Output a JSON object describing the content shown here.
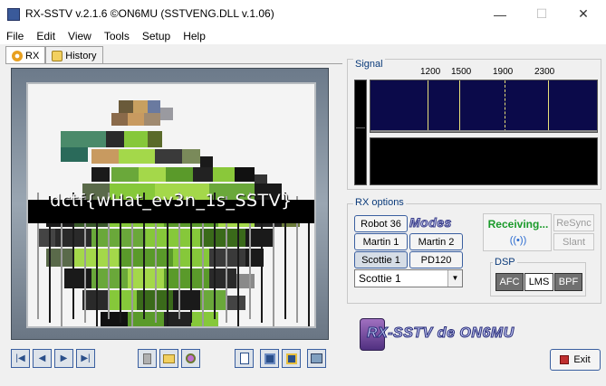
{
  "window": {
    "title": "RX-SSTV v.2.1.6 ©ON6MU (SSTVENG.DLL v.1.06)",
    "controls": {
      "minimize": "—",
      "maximize": "☐",
      "close": "✕"
    }
  },
  "menu": [
    "File",
    "Edit",
    "View",
    "Tools",
    "Setup",
    "Help"
  ],
  "tabs": [
    {
      "label": "RX",
      "icon": "gear-icon"
    },
    {
      "label": "History",
      "icon": "history-icon"
    }
  ],
  "image": {
    "overlay_text": "dctf{wHat_ev3n_1s_SSTV}"
  },
  "toolbar": {
    "nav": [
      "first-icon",
      "prev-icon",
      "next-icon",
      "last-icon"
    ],
    "file": [
      "trash-icon",
      "open-folder-icon",
      "zoom-icon"
    ],
    "save": [
      "copy-icon",
      "save-icon",
      "save-as-icon",
      "scan-icon"
    ]
  },
  "signal": {
    "label": "Signal",
    "freqs": [
      "1200",
      "1500",
      "1900",
      "2300"
    ]
  },
  "rx_options": {
    "label": "RX options",
    "modes_logo": "Modes",
    "buttons": {
      "robot36": "Robot 36",
      "martin1": "Martin 1",
      "martin2": "Martin 2",
      "scottie1": "Scottie 1",
      "pd120": "PD120"
    },
    "selected_mode": "Scottie 1",
    "status": "Receiving...",
    "resync": "ReSync",
    "slant": "Slant"
  },
  "dsp": {
    "label": "DSP",
    "afc": "AFC",
    "lms": "LMS",
    "bpf": "BPF"
  },
  "logo": {
    "text": "RX-SSTV de ON6MU"
  },
  "exit_label": "Exit",
  "colors": {
    "accent": "#3a5fa0",
    "receiving": "#1a9a2a",
    "signal_bg": "#0b0a4a",
    "waterfall_line": "#e8e07a"
  }
}
